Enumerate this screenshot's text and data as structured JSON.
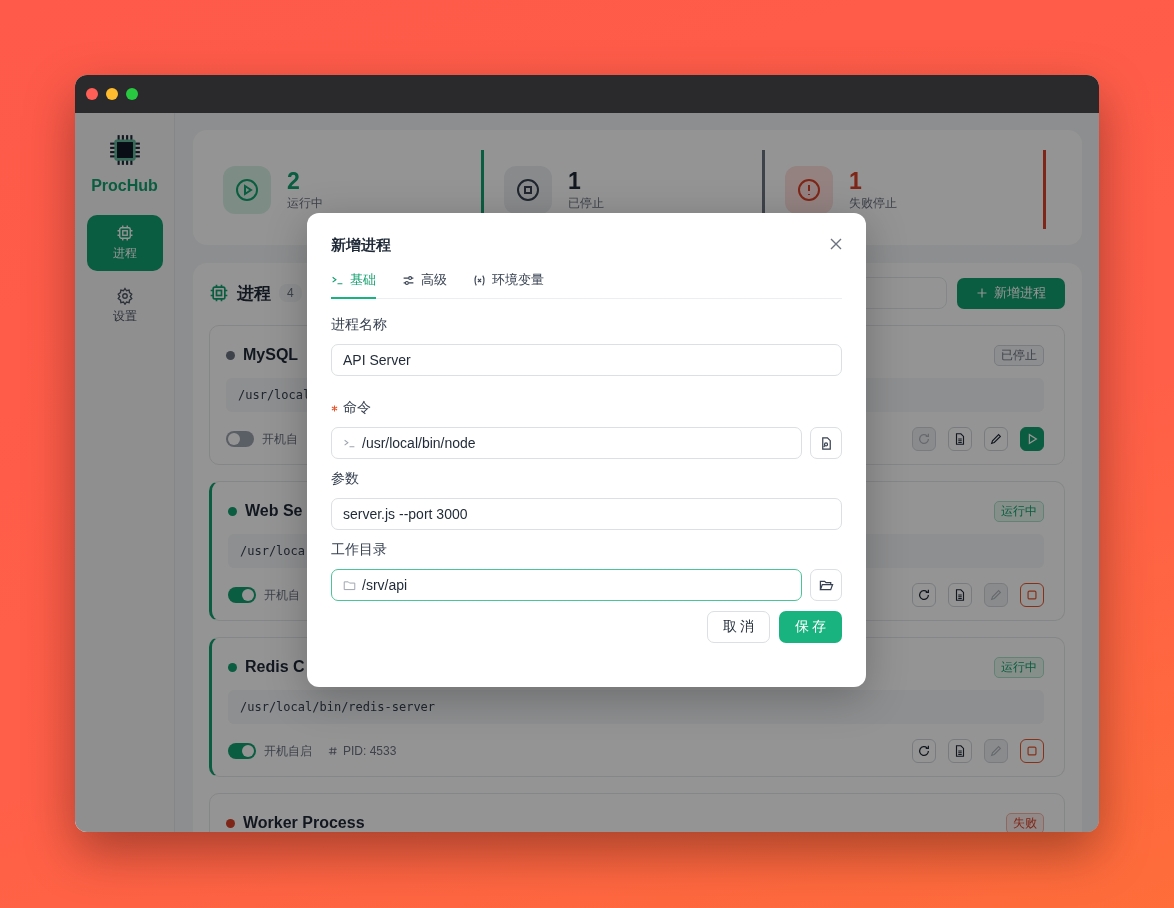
{
  "sidebar": {
    "brand": "ProcHub",
    "items": [
      {
        "label": "进程",
        "selected": true,
        "kind": "chip"
      },
      {
        "label": "设置",
        "selected": false,
        "kind": "gear"
      }
    ]
  },
  "stats": [
    {
      "value": "2",
      "label": "运行中",
      "kind": "running"
    },
    {
      "value": "1",
      "label": "已停止",
      "kind": "stopped"
    },
    {
      "value": "1",
      "label": "失败停止",
      "kind": "failed"
    }
  ],
  "panel": {
    "title": "进程",
    "count": "4",
    "add_button": "新增进程"
  },
  "processes": [
    {
      "name": "MySQL",
      "kind": "stopped",
      "status_label": "已停止",
      "command": "/usr/local",
      "autostart": false,
      "autostart_label": "开机自"
    },
    {
      "name": "Web Se",
      "kind": "running",
      "status_label": "运行中",
      "command": "/usr/loca",
      "autostart": true,
      "autostart_label": "开机自"
    },
    {
      "name": "Redis C",
      "kind": "running",
      "status_label": "运行中",
      "command": "/usr/local/bin/redis-server",
      "autostart": true,
      "autostart_label": "开机自启",
      "pid": "PID: 4533"
    },
    {
      "name": "Worker Process",
      "kind": "failed",
      "status_label": "失败"
    }
  ],
  "dialog": {
    "title": "新增进程",
    "tabs": [
      {
        "label": "基础",
        "selected": true,
        "kind": "terminal"
      },
      {
        "label": "高级",
        "selected": false,
        "kind": "sliders"
      },
      {
        "label": "环境变量",
        "selected": false,
        "kind": "variable"
      }
    ],
    "fields": [
      {
        "label": "进程名称",
        "required": false,
        "value": "API Server",
        "kind": "plain",
        "focused": false
      },
      {
        "label": "命令",
        "required": true,
        "value": "/usr/local/bin/node",
        "kind": "command",
        "focused": false
      },
      {
        "label": "参数",
        "required": false,
        "value": "server.js --port 3000",
        "kind": "plain",
        "focused": false
      },
      {
        "label": "工作目录",
        "required": false,
        "value": "/srv/api",
        "kind": "directory",
        "focused": true
      }
    ],
    "cancel": "取 消",
    "save": "保 存"
  }
}
